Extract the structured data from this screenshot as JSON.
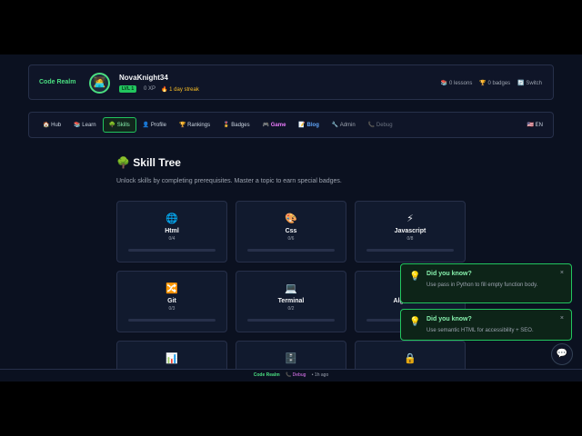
{
  "header": {
    "brand": "Code Realm",
    "avatar_emoji": "🧑‍💻",
    "username": "NovaKnight34",
    "level_badge": "LVL 1",
    "xp": "0 XP",
    "streak": "🔥 1 day streak",
    "lessons": "📚 0 lessons",
    "badges": "🏆 0 badges",
    "switch": "🔄 Switch"
  },
  "nav": {
    "items": [
      {
        "label": "🏠 Hub"
      },
      {
        "label": "📚 Learn"
      },
      {
        "label": "🌳 Skills"
      },
      {
        "label": "👤 Profile"
      },
      {
        "label": "🏆 Rankings"
      },
      {
        "label": "🎖️ Badges"
      },
      {
        "label": "🎮 Game"
      },
      {
        "label": "📝 Blog"
      },
      {
        "label": "🔧 Admin"
      },
      {
        "label": "📞 Debug"
      }
    ],
    "language": "🇺🇸 EN"
  },
  "page": {
    "title": "🌳 Skill Tree",
    "subtitle": "Unlock skills by completing prerequisites. Master a topic to earn special badges."
  },
  "skills": [
    {
      "icon": "🌐",
      "name": "Html",
      "count": "0/4",
      "progress": 0
    },
    {
      "icon": "🎨",
      "name": "Css",
      "count": "0/6",
      "progress": 0
    },
    {
      "icon": "⚡",
      "name": "Javascript",
      "count": "0/8",
      "progress": 0
    },
    {
      "icon": "🔀",
      "name": "Git",
      "count": "0/3",
      "progress": 0
    },
    {
      "icon": "💻",
      "name": "Terminal",
      "count": "0/2",
      "progress": 0
    },
    {
      "icon": "🧮",
      "name": "Algorithms",
      "count": "",
      "progress": 0
    },
    {
      "icon": "📊",
      "name": "",
      "count": "",
      "progress": 0
    },
    {
      "icon": "🗄️",
      "name": "",
      "count": "",
      "progress": 0
    },
    {
      "icon": "🔒",
      "name": "",
      "count": "",
      "progress": 0
    }
  ],
  "toasts": [
    {
      "icon": "💡",
      "title": "Did you know?",
      "body": "Use pass in Python to fill empty function body.",
      "close": "×"
    },
    {
      "icon": "💡",
      "title": "Did you know?",
      "body": "Use semantic HTML for accessibility + SEO.",
      "close": "×"
    }
  ],
  "chat_icon": "💬",
  "footer": {
    "brand": "Code Realm",
    "debug": "📞 Debug",
    "updated": "• 1h ago"
  },
  "colors": {
    "accent": "#22c55e",
    "background": "#0b1120",
    "panel": "#0f1528",
    "game": "#e879f9",
    "blog": "#60a5fa"
  }
}
